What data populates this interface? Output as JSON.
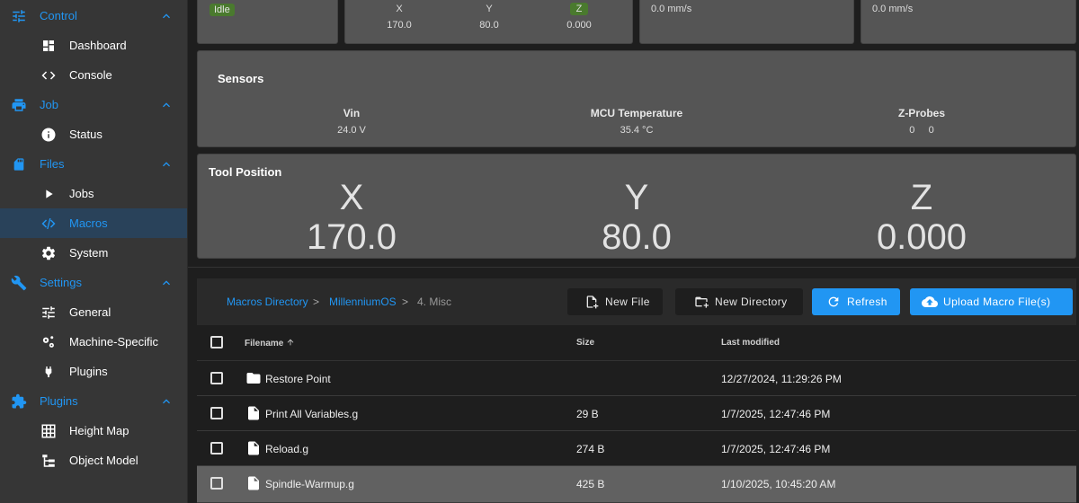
{
  "sidebar": {
    "groups": [
      {
        "label": "Control",
        "icon": "sliders-icon",
        "items": [
          {
            "label": "Dashboard",
            "icon": "dashboard-icon"
          },
          {
            "label": "Console",
            "icon": "code-icon"
          }
        ]
      },
      {
        "label": "Job",
        "icon": "printer-icon",
        "items": [
          {
            "label": "Status",
            "icon": "info-icon"
          }
        ]
      },
      {
        "label": "Files",
        "icon": "sd-card-icon",
        "items": [
          {
            "label": "Jobs",
            "icon": "play-icon"
          },
          {
            "label": "Macros",
            "icon": "macro-icon",
            "active": true
          },
          {
            "label": "System",
            "icon": "gear-icon"
          }
        ]
      },
      {
        "label": "Settings",
        "icon": "wrench-icon",
        "items": [
          {
            "label": "General",
            "icon": "sliders-icon"
          },
          {
            "label": "Machine-Specific",
            "icon": "gears-icon"
          },
          {
            "label": "Plugins",
            "icon": "plug-icon"
          }
        ]
      },
      {
        "label": "Plugins",
        "icon": "puzzle-icon",
        "items": [
          {
            "label": "Height Map",
            "icon": "grid-icon"
          },
          {
            "label": "Object Model",
            "icon": "tree-icon"
          }
        ]
      }
    ]
  },
  "status": {
    "state": "Idle",
    "axes": [
      {
        "name": "X",
        "value": "170.0",
        "highlight": false
      },
      {
        "name": "Y",
        "value": "80.0",
        "highlight": false
      },
      {
        "name": "Z",
        "value": "0.000",
        "highlight": true
      }
    ],
    "speed1": "0.0 mm/s",
    "speed2": "0.0 mm/s"
  },
  "sensors": {
    "title": "Sensors",
    "vin_label": "Vin",
    "vin_value": "24.0 V",
    "mcu_label": "MCU Temperature",
    "mcu_value": "35.4 °C",
    "probes_label": "Z-Probes",
    "probes_value": "0     0"
  },
  "tool_position": {
    "title": "Tool Position",
    "x_label": "X",
    "x_value": "170.0",
    "y_label": "Y",
    "y_value": "80.0",
    "z_label": "Z",
    "z_value": "0.000"
  },
  "files": {
    "breadcrumb": [
      "Macros Directory",
      "MillenniumOS",
      "4. Misc"
    ],
    "sep": ">",
    "buttons": {
      "new_file": "New File",
      "new_directory": "New Directory",
      "refresh": "Refresh",
      "upload": "Upload Macro File(s)"
    },
    "headers": {
      "filename": "Filename",
      "size": "Size",
      "modified": "Last modified"
    },
    "rows": [
      {
        "type": "folder",
        "name": "Restore Point",
        "size": "",
        "modified": "12/27/2024, 11:29:26 PM"
      },
      {
        "type": "file",
        "name": "Print All Variables.g",
        "size": "29 B",
        "modified": "1/7/2025, 12:47:46 PM"
      },
      {
        "type": "file",
        "name": "Reload.g",
        "size": "274 B",
        "modified": "1/7/2025, 12:47:46 PM"
      },
      {
        "type": "file",
        "name": "Spindle-Warmup.g",
        "size": "425 B",
        "modified": "1/10/2025, 10:45:20 AM"
      }
    ]
  },
  "colors": {
    "accent": "#2196f3",
    "sidebar_bg": "#363636",
    "card_bg": "#555555",
    "idle_chip": "#4a7a2e"
  }
}
